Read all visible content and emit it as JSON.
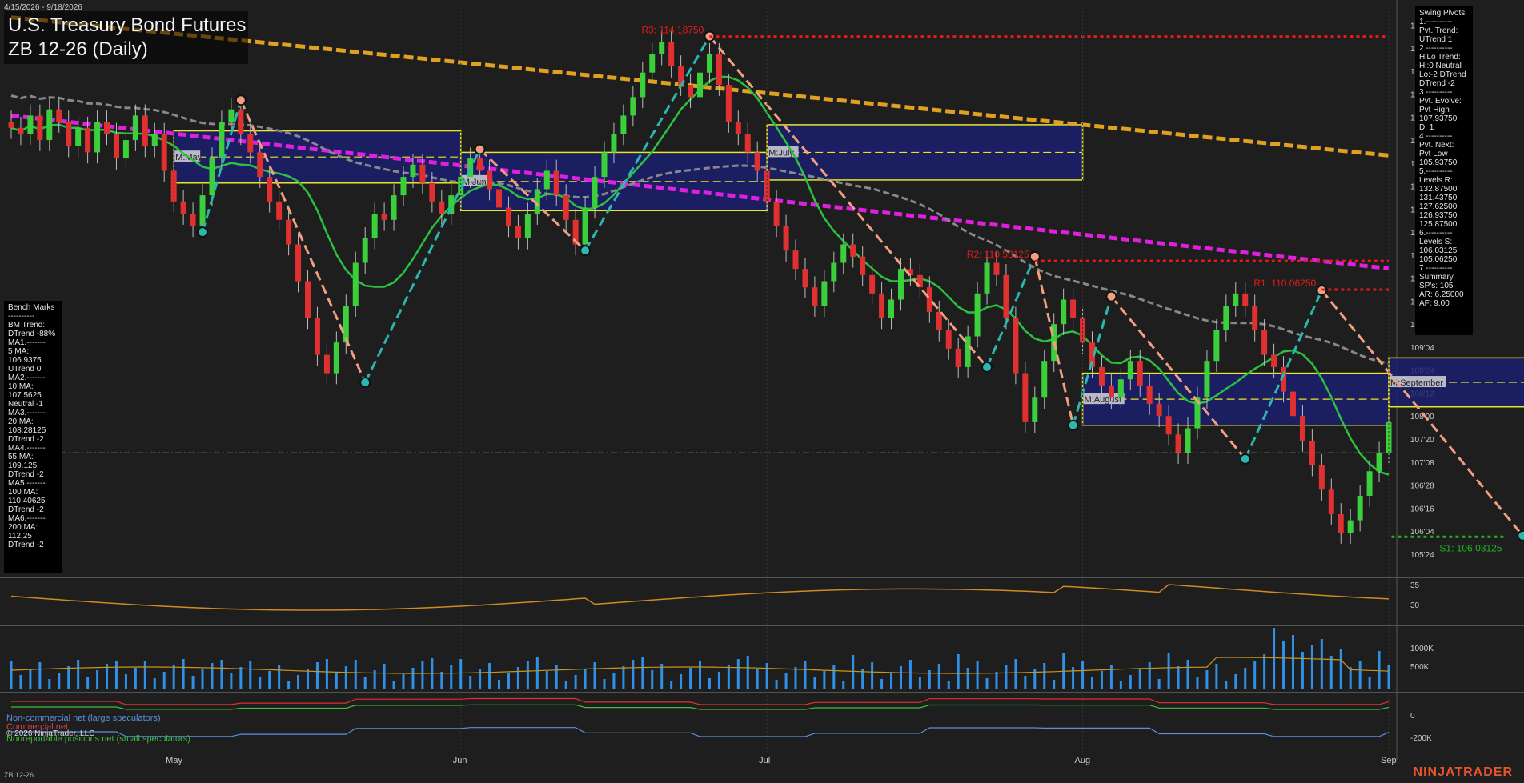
{
  "header": {
    "date_range": "4/15/2026 - 9/18/2026",
    "title": "U.S. Treasury Bond Futures",
    "subtitle": "ZB 12-26 (Daily)"
  },
  "footer": {
    "symbol": "ZB 12-26",
    "brand": "NINJATRADER",
    "copyright": "© 2026 NinjaTrader, LLC"
  },
  "cot_legend": {
    "noncommercial": "Non-commercial net (large speculators)",
    "commercial": "Commercial net",
    "nonreportable": "Nonreportable positions net (small speculators)"
  },
  "bench_marks": {
    "lines": [
      "Bench Marks",
      "----------",
      "BM Trend:",
      "DTrend -88%",
      "MA1.-------",
      "5 MA:",
      "106.9375",
      "UTrend 0",
      "MA2.-------",
      "10 MA:",
      "107.5625",
      "Neutral -1",
      "MA3.-------",
      "20 MA:",
      "108.28125",
      "DTrend -2",
      "MA4.-------",
      "55 MA:",
      "109.125",
      "DTrend -2",
      "MA5.-------",
      "100 MA:",
      "110.40625",
      "DTrend -2",
      "MA6.-------",
      "200 MA:",
      "112.25",
      "DTrend -2"
    ]
  },
  "swing_pivots": {
    "lines": [
      "Swing Pivots",
      "1.----------",
      "Pvt. Trend:",
      "UTrend 1",
      "2.----------",
      "HiLo Trend:",
      "Hi:0 Neutral",
      "Lo:-2 DTrend",
      "DTrend -2",
      "3.----------",
      "Pvt. Evolve:",
      "Pvt High",
      "107.93750",
      "D: 1",
      "4.----------",
      "Pvt. Next:",
      "Pvt Low",
      "105.93750",
      "5.----------",
      "Levels R:",
      "132.87500",
      "131.43750",
      "127.62500",
      "126.93750",
      "125.87500",
      "6.----------",
      "Levels S:",
      "106.03125",
      "105.06250",
      "7.----------",
      "Summary",
      "SP's: 105",
      "AR: 6.25000",
      "AF: 9.00"
    ]
  },
  "chart_data": {
    "type": "candlestick",
    "price_axis": {
      "ylim": [
        105.5,
        114.6
      ],
      "tick_labels": [
        "114'12",
        "114'00",
        "113'20",
        "113'08",
        "112'28",
        "112'16",
        "112'04",
        "111'24",
        "111'12",
        "111'00",
        "110'20",
        "110'08",
        "109'28",
        "109'16",
        "109'04",
        "108'24",
        "108'12",
        "108'00",
        "107'20",
        "107'08",
        "106'28",
        "106'16",
        "106'04",
        "105'24"
      ],
      "tick_values": [
        114.375,
        114.0,
        113.625,
        113.25,
        112.875,
        112.5,
        112.125,
        111.75,
        111.375,
        111.0,
        110.625,
        110.25,
        109.875,
        109.5,
        109.125,
        108.75,
        108.375,
        108.0,
        107.625,
        107.25,
        106.875,
        106.5,
        106.125,
        105.75
      ]
    },
    "month_labels": [
      "May",
      "Jun",
      "Jul",
      "Aug",
      "Sep"
    ],
    "month_index": [
      17,
      47,
      79,
      112,
      144
    ],
    "levels": [
      {
        "label": "R3: 114.18750",
        "value": 114.1875,
        "color": "#e41b1b"
      },
      {
        "label": "R2: 110.53125",
        "value": 110.53125,
        "color": "#e41b1b"
      },
      {
        "label": "R1: 110.06250",
        "value": 110.0625,
        "color": "#e41b1b"
      },
      {
        "label": "S1: 106.03125",
        "value": 106.03125,
        "color": "#22b322"
      }
    ],
    "monthly_boxes": [
      {
        "label": "M:May",
        "start": 17,
        "end": 47,
        "high": 112.65,
        "low": 111.8
      },
      {
        "label": "M:June",
        "start": 47,
        "end": 79,
        "high": 112.3,
        "low": 111.35
      },
      {
        "label": "M:July",
        "start": 79,
        "end": 112,
        "high": 112.75,
        "low": 111.85
      },
      {
        "label": "M:August",
        "start": 112,
        "end": 144,
        "high": 108.7,
        "low": 107.85
      },
      {
        "label": "M:September",
        "start": 144,
        "end": 162,
        "high": 108.95,
        "low": 108.15
      }
    ],
    "swing_points": [
      {
        "i": 20,
        "v": 111.0,
        "t": "low"
      },
      {
        "i": 24,
        "v": 113.15,
        "t": "high"
      },
      {
        "i": 37,
        "v": 108.55,
        "t": "low"
      },
      {
        "i": 49,
        "v": 112.35,
        "t": "high"
      },
      {
        "i": 60,
        "v": 110.7,
        "t": "low"
      },
      {
        "i": 73,
        "v": 114.19,
        "t": "high"
      },
      {
        "i": 102,
        "v": 108.8,
        "t": "low"
      },
      {
        "i": 107,
        "v": 110.6,
        "t": "high"
      },
      {
        "i": 111,
        "v": 107.85,
        "t": "low"
      },
      {
        "i": 115,
        "v": 109.95,
        "t": "high"
      },
      {
        "i": 129,
        "v": 107.3,
        "t": "low"
      },
      {
        "i": 137,
        "v": 110.05,
        "t": "high"
      },
      {
        "i": 158,
        "v": 106.05,
        "t": "low"
      },
      {
        "i": 163,
        "v": 107.92,
        "t": "high"
      }
    ],
    "candles_close": [
      112.7,
      112.6,
      112.9,
      112.5,
      113.0,
      112.8,
      112.4,
      112.7,
      112.3,
      112.8,
      112.6,
      112.2,
      112.5,
      112.9,
      112.4,
      112.6,
      112.0,
      111.5,
      111.3,
      111.1,
      111.6,
      112.2,
      112.8,
      113.0,
      112.6,
      112.3,
      111.9,
      111.5,
      111.2,
      110.8,
      110.2,
      109.6,
      109.0,
      108.7,
      109.2,
      109.8,
      110.5,
      110.9,
      111.3,
      111.2,
      111.6,
      111.9,
      112.1,
      111.8,
      111.5,
      111.3,
      111.6,
      111.9,
      112.2,
      112.0,
      111.7,
      111.4,
      111.1,
      110.9,
      111.3,
      111.7,
      112.0,
      111.6,
      111.2,
      110.8,
      111.4,
      111.9,
      112.3,
      112.6,
      112.9,
      113.2,
      113.6,
      113.9,
      114.1,
      113.7,
      113.4,
      113.2,
      113.6,
      113.9,
      113.4,
      112.8,
      112.6,
      112.3,
      112.0,
      111.5,
      111.1,
      110.7,
      110.4,
      110.1,
      109.8,
      110.2,
      110.5,
      110.8,
      110.6,
      110.3,
      110.0,
      109.6,
      109.9,
      110.4,
      110.3,
      110.1,
      109.7,
      109.4,
      109.1,
      108.8,
      109.3,
      110.0,
      110.5,
      110.3,
      109.6,
      108.7,
      107.9,
      108.3,
      108.9,
      109.5,
      109.9,
      109.6,
      109.2,
      108.8,
      108.5,
      108.3,
      108.6,
      108.9,
      108.5,
      108.2,
      108.0,
      107.7,
      107.4,
      107.8,
      108.3,
      108.9,
      109.4,
      109.8,
      110.0,
      109.8,
      109.4,
      109.0,
      108.8,
      108.4,
      108.0,
      107.6,
      107.2,
      106.8,
      106.4,
      106.1,
      106.3,
      106.7,
      107.1,
      107.4,
      107.9
    ],
    "moving_averages": [
      {
        "name": "200 MA",
        "color": "#e0a020",
        "start": 114.5,
        "end": 112.25,
        "dash": "12 5"
      },
      {
        "name": "100 MA",
        "color": "#e020e0",
        "start": 112.9,
        "end": 110.40625,
        "dash": "10 5"
      },
      {
        "name": "55 MA",
        "color": "#888888",
        "start": 113.2,
        "end": 109.125,
        "dash": "8 4"
      },
      {
        "name": "20 MA",
        "color": "#2cc040",
        "start": 112.8,
        "end": 108.28125,
        "dash": ""
      }
    ],
    "indicator_axis_labels": [
      "35",
      "30"
    ],
    "volume_axis_labels": [
      "1000K",
      "500K"
    ],
    "cot_axis_labels": [
      "0",
      "-200K"
    ]
  }
}
